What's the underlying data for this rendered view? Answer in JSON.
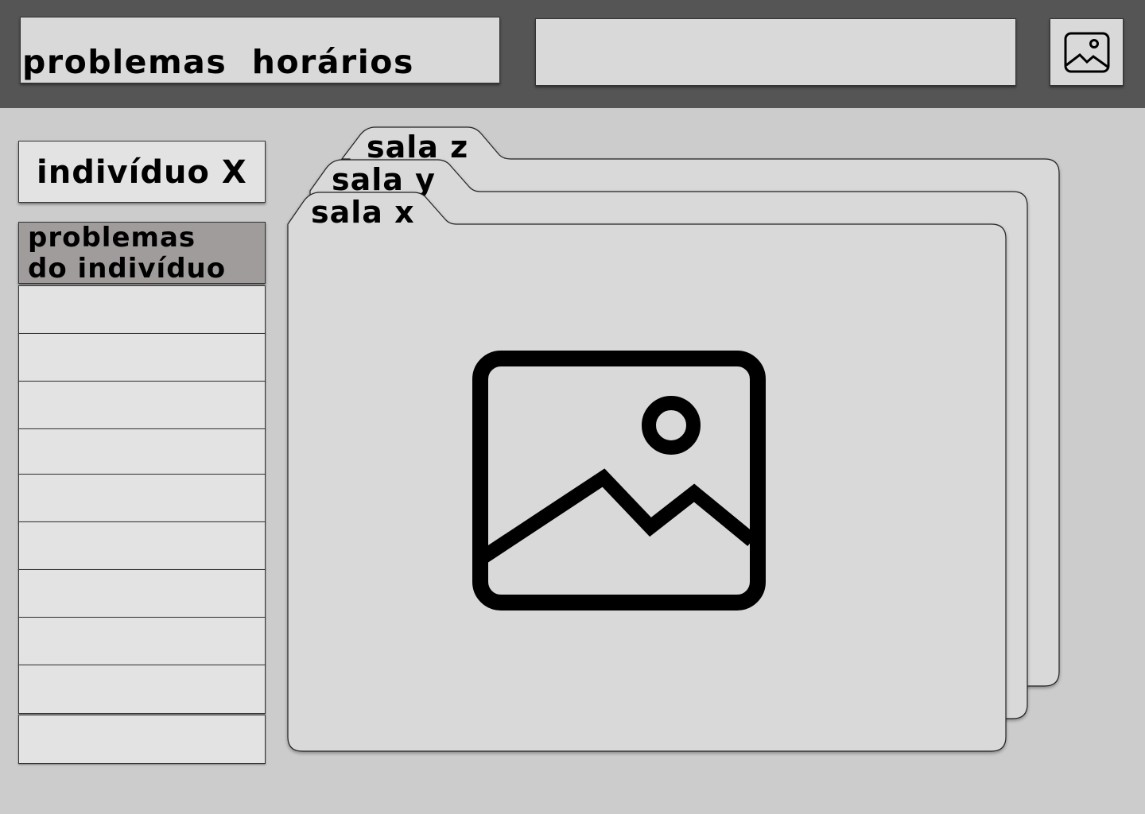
{
  "header": {
    "title": "problemas  horários",
    "search": {
      "value": "",
      "placeholder": ""
    },
    "avatar_icon": "image-icon"
  },
  "sidebar": {
    "individual": "indivíduo X",
    "section_header": "problemas\ndo indivíduo",
    "rows": [
      {
        "label": ""
      },
      {
        "label": ""
      },
      {
        "label": ""
      },
      {
        "label": ""
      },
      {
        "label": ""
      },
      {
        "label": ""
      },
      {
        "label": ""
      },
      {
        "label": ""
      },
      {
        "label": ""
      },
      {
        "label": ""
      }
    ]
  },
  "main": {
    "tabs": [
      {
        "label": "sala z",
        "active": false
      },
      {
        "label": "sala y",
        "active": false
      },
      {
        "label": "sala x",
        "active": true
      }
    ],
    "content_icon": "image-icon"
  },
  "colors": {
    "header_bg": "#555555",
    "page_bg": "#cccccc",
    "panel_bg": "#d9d9d9",
    "selected_header_bg": "#a09c9c"
  }
}
